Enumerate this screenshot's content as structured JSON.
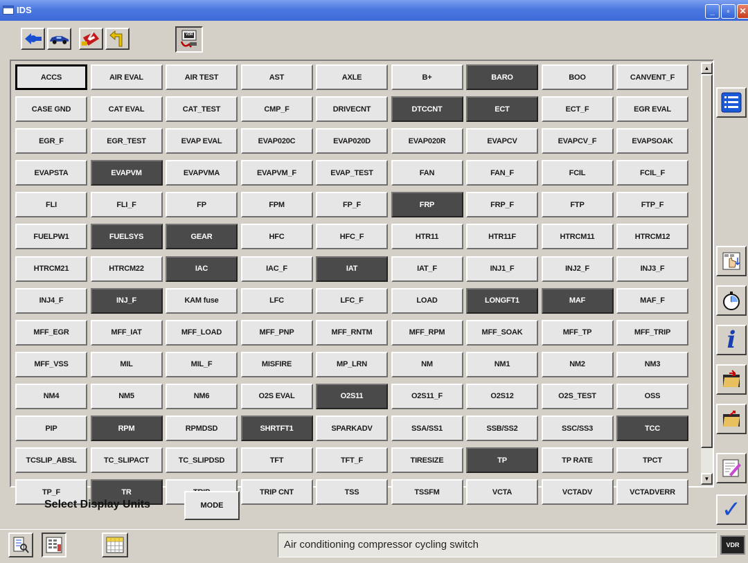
{
  "window": {
    "title": "IDS",
    "controls": {
      "minimize": "_",
      "maximize": "▫",
      "close": "✕"
    }
  },
  "toolbar": {
    "tabs": [
      {
        "name": "back",
        "icon": "arrow-left-icon"
      },
      {
        "name": "vehicle",
        "icon": "car-icon"
      },
      {
        "name": "toolbox",
        "icon": "toolbox-icon"
      },
      {
        "name": "direction",
        "icon": "direction-arrow-icon"
      },
      {
        "name": "vdr",
        "icon": "vdr-icon",
        "label": "VDR"
      }
    ]
  },
  "pid_buttons": [
    {
      "label": "ACCS",
      "state": "focused"
    },
    {
      "label": "AIR EVAL"
    },
    {
      "label": "AIR TEST"
    },
    {
      "label": "AST"
    },
    {
      "label": "AXLE"
    },
    {
      "label": "B+"
    },
    {
      "label": "BARO",
      "state": "selected"
    },
    {
      "label": "BOO"
    },
    {
      "label": "CANVENT_F"
    },
    {
      "label": "CASE GND"
    },
    {
      "label": "CAT EVAL"
    },
    {
      "label": "CAT_TEST"
    },
    {
      "label": "CMP_F"
    },
    {
      "label": "DRIVECNT"
    },
    {
      "label": "DTCCNT",
      "state": "selected"
    },
    {
      "label": "ECT",
      "state": "selected"
    },
    {
      "label": "ECT_F"
    },
    {
      "label": "EGR EVAL"
    },
    {
      "label": "EGR_F"
    },
    {
      "label": "EGR_TEST"
    },
    {
      "label": "EVAP EVAL"
    },
    {
      "label": "EVAP020C"
    },
    {
      "label": "EVAP020D"
    },
    {
      "label": "EVAP020R"
    },
    {
      "label": "EVAPCV"
    },
    {
      "label": "EVAPCV_F"
    },
    {
      "label": "EVAPSOAK"
    },
    {
      "label": "EVAPSTA"
    },
    {
      "label": "EVAPVM",
      "state": "selected"
    },
    {
      "label": "EVAPVMA"
    },
    {
      "label": "EVAPVM_F"
    },
    {
      "label": "EVAP_TEST"
    },
    {
      "label": "FAN"
    },
    {
      "label": "FAN_F"
    },
    {
      "label": "FCIL"
    },
    {
      "label": "FCIL_F"
    },
    {
      "label": "FLI"
    },
    {
      "label": "FLI_F"
    },
    {
      "label": "FP"
    },
    {
      "label": "FPM"
    },
    {
      "label": "FP_F"
    },
    {
      "label": "FRP",
      "state": "selected"
    },
    {
      "label": "FRP_F"
    },
    {
      "label": "FTP"
    },
    {
      "label": "FTP_F"
    },
    {
      "label": "FUELPW1"
    },
    {
      "label": "FUELSYS",
      "state": "selected"
    },
    {
      "label": "GEAR",
      "state": "selected"
    },
    {
      "label": "HFC"
    },
    {
      "label": "HFC_F"
    },
    {
      "label": "HTR11"
    },
    {
      "label": "HTR11F"
    },
    {
      "label": "HTRCM11"
    },
    {
      "label": "HTRCM12"
    },
    {
      "label": "HTRCM21"
    },
    {
      "label": "HTRCM22"
    },
    {
      "label": "IAC",
      "state": "selected"
    },
    {
      "label": "IAC_F"
    },
    {
      "label": "IAT",
      "state": "selected"
    },
    {
      "label": "IAT_F"
    },
    {
      "label": "INJ1_F"
    },
    {
      "label": "INJ2_F"
    },
    {
      "label": "INJ3_F"
    },
    {
      "label": "INJ4_F"
    },
    {
      "label": "INJ_F",
      "state": "selected"
    },
    {
      "label": "KAM fuse"
    },
    {
      "label": "LFC"
    },
    {
      "label": "LFC_F"
    },
    {
      "label": "LOAD"
    },
    {
      "label": "LONGFT1",
      "state": "selected"
    },
    {
      "label": "MAF",
      "state": "selected"
    },
    {
      "label": "MAF_F"
    },
    {
      "label": "MFF_EGR"
    },
    {
      "label": "MFF_IAT"
    },
    {
      "label": "MFF_LOAD"
    },
    {
      "label": "MFF_PNP"
    },
    {
      "label": "MFF_RNTM"
    },
    {
      "label": "MFF_RPM"
    },
    {
      "label": "MFF_SOAK"
    },
    {
      "label": "MFF_TP"
    },
    {
      "label": "MFF_TRIP"
    },
    {
      "label": "MFF_VSS"
    },
    {
      "label": "MIL"
    },
    {
      "label": "MIL_F"
    },
    {
      "label": "MISFIRE"
    },
    {
      "label": "MP_LRN"
    },
    {
      "label": "NM"
    },
    {
      "label": "NM1"
    },
    {
      "label": "NM2"
    },
    {
      "label": "NM3"
    },
    {
      "label": "NM4"
    },
    {
      "label": "NM5"
    },
    {
      "label": "NM6"
    },
    {
      "label": "O2S EVAL"
    },
    {
      "label": "O2S11",
      "state": "selected"
    },
    {
      "label": "O2S11_F"
    },
    {
      "label": "O2S12"
    },
    {
      "label": "O2S_TEST"
    },
    {
      "label": "OSS"
    },
    {
      "label": "PIP"
    },
    {
      "label": "RPM",
      "state": "selected"
    },
    {
      "label": "RPMDSD"
    },
    {
      "label": "SHRTFT1",
      "state": "selected"
    },
    {
      "label": "SPARKADV"
    },
    {
      "label": "SSA/SS1"
    },
    {
      "label": "SSB/SS2"
    },
    {
      "label": "SSC/SS3"
    },
    {
      "label": "TCC",
      "state": "selected"
    },
    {
      "label": "TCSLIP_ABSL"
    },
    {
      "label": "TC_SLIPACT"
    },
    {
      "label": "TC_SLIPDSD"
    },
    {
      "label": "TFT"
    },
    {
      "label": "TFT_F"
    },
    {
      "label": "TIRESIZE"
    },
    {
      "label": "TP",
      "state": "selected"
    },
    {
      "label": "TP RATE"
    },
    {
      "label": "TPCT"
    },
    {
      "label": "TP_F"
    },
    {
      "label": "TR",
      "state": "selected"
    },
    {
      "label": "TRIP"
    },
    {
      "label": "TRIP CNT"
    },
    {
      "label": "TSS"
    },
    {
      "label": "TSSFM"
    },
    {
      "label": "VCTA"
    },
    {
      "label": "VCTADV"
    },
    {
      "label": "VCTADVERR"
    }
  ],
  "units": {
    "label": "Select Display Units",
    "mode_button": "MODE"
  },
  "side_buttons": [
    {
      "name": "list",
      "icon": "list-icon"
    },
    {
      "name": "select-pid",
      "icon": "hand-select-icon"
    },
    {
      "name": "timer",
      "icon": "stopwatch-icon"
    },
    {
      "name": "info",
      "icon": "info-icon",
      "glyph": "i"
    },
    {
      "name": "open-folder",
      "icon": "folder-open-icon"
    },
    {
      "name": "save-folder",
      "icon": "folder-save-icon"
    },
    {
      "name": "edit",
      "icon": "edit-icon"
    },
    {
      "name": "confirm",
      "icon": "checkmark-icon",
      "glyph": "✓"
    }
  ],
  "bottom_tabs": [
    {
      "name": "data-logger",
      "icon": "data-logger-icon"
    },
    {
      "name": "pid-list",
      "icon": "pid-list-icon"
    },
    {
      "name": "datalog-grid",
      "icon": "grid-icon"
    }
  ],
  "status": {
    "text": "Air conditioning compressor cycling switch"
  },
  "vdr_indicator": {
    "label": "VDR"
  },
  "colors": {
    "titlebar": "#3d6ad8",
    "button": "#e6e6e6",
    "selected": "#4a4a4a",
    "background": "#d4d0c8",
    "accent": "#1a4fd0"
  }
}
